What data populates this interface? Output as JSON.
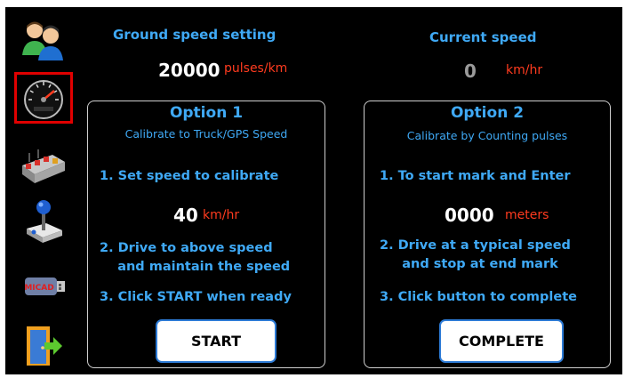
{
  "sidebar": {
    "items": [
      {
        "name": "users",
        "icon": "users-icon"
      },
      {
        "name": "speedometer",
        "icon": "speedometer-icon",
        "active": true
      },
      {
        "name": "valves",
        "icon": "valve-block-icon"
      },
      {
        "name": "joystick",
        "icon": "joystick-icon"
      },
      {
        "name": "usb",
        "icon": "usb-drive-icon",
        "usb_text": "MICAD"
      },
      {
        "name": "exit",
        "icon": "exit-door-icon"
      }
    ]
  },
  "header": {
    "ground_speed_label": "Ground speed setting",
    "ground_speed_value": "20000",
    "ground_speed_unit": "pulses/km",
    "current_speed_label": "Current speed",
    "current_speed_value": "0",
    "current_speed_unit": "km/hr"
  },
  "option1": {
    "title": "Option 1",
    "subtitle": "Calibrate to Truck/GPS Speed",
    "step1": "1. Set speed to calibrate",
    "speed_value": "40",
    "speed_unit": "km/hr",
    "step2": "2. Drive to above speed\n    and maintain the speed",
    "step3": "3. Click START when ready",
    "button": "START"
  },
  "option2": {
    "title": "Option 2",
    "subtitle": "Calibrate by Counting pulses",
    "step1": "1. To start mark and Enter",
    "distance_value": "0000",
    "distance_unit": "meters",
    "step2": "2. Drive at a typical speed\n     and stop at end mark",
    "step3": "3. Click button to complete",
    "button": "COMPLETE"
  },
  "colors": {
    "label_blue": "#3fa9f5",
    "unit_red": "#ff3b1f",
    "active_border": "#e00000",
    "background": "#000000"
  }
}
